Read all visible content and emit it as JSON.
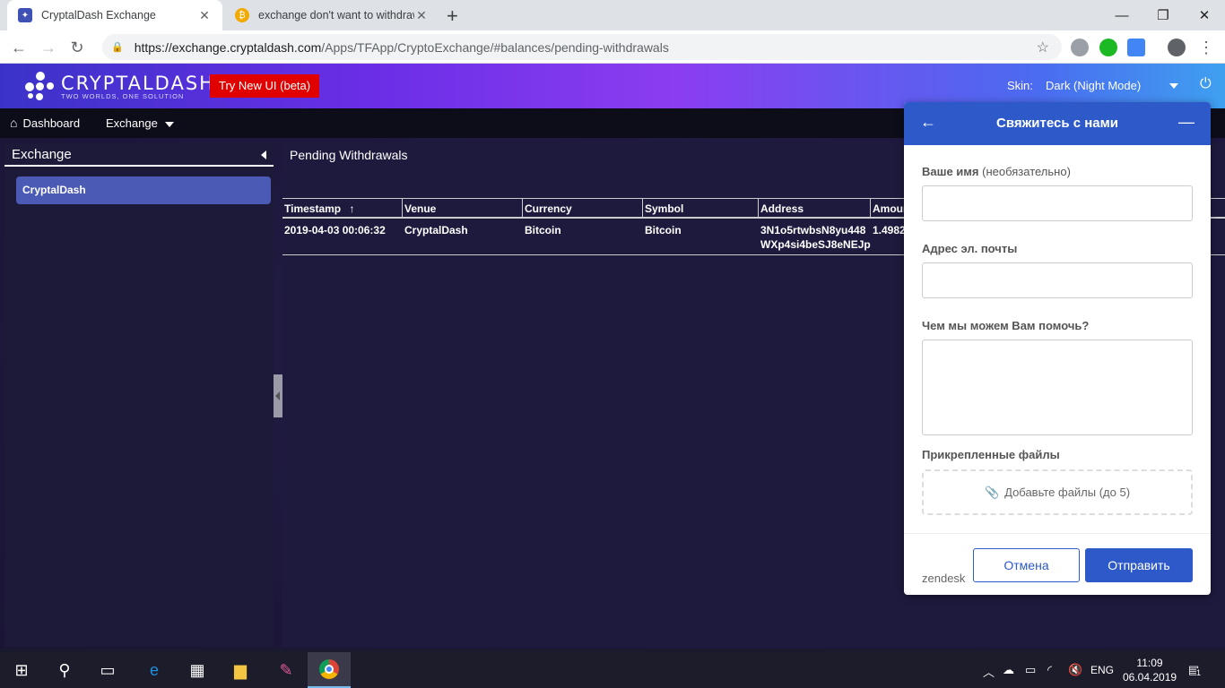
{
  "browser": {
    "tabs": [
      {
        "title": "CryptalDash Exchange",
        "active": true
      },
      {
        "title": "exchange don't want to withdraw",
        "active": false
      }
    ],
    "url_host": "https://exchange.cryptaldash.com",
    "url_path": "/Apps/TFApp/CryptoExchange/#balances/pending-withdrawals"
  },
  "header": {
    "logo_name": "CRYPTALDASH",
    "logo_tagline": "TWO WORLDS, ONE SOLUTION",
    "try_new_label": "Try New UI (beta)",
    "skin_label": "Skin:",
    "skin_value": "Dark (Night Mode)"
  },
  "navbar": {
    "dashboard": "Dashboard",
    "exchange": "Exchange"
  },
  "sidebar": {
    "title": "Exchange",
    "items": [
      {
        "label": "CryptalDash"
      }
    ]
  },
  "main": {
    "title": "Pending Withdrawals",
    "columns": [
      "Timestamp",
      "Venue",
      "Currency",
      "Symbol",
      "Address",
      "Amoun"
    ],
    "rows": [
      {
        "timestamp": "2019-04-03 00:06:32",
        "venue": "CryptalDash",
        "currency": "Bitcoin",
        "symbol": "Bitcoin",
        "address_line1": "3N1o5rtwbsN8yu448",
        "address_line2": "WXp4si4beSJ8eNEJp",
        "amount": "1.4982"
      }
    ]
  },
  "zendesk": {
    "title": "Свяжитесь с нами",
    "name_label": "Ваше имя",
    "name_optional": "(необязательно)",
    "email_label": "Адрес эл. почты",
    "help_label": "Чем мы можем Вам помочь?",
    "attachments_label": "Прикрепленные файлы",
    "attach_button": "Добавьте файлы (до 5)",
    "brand": "zendesk",
    "cancel_label": "Отмена",
    "send_label": "Отправить"
  },
  "taskbar": {
    "language": "ENG",
    "time": "11:09",
    "date": "06.04.2019",
    "notification_count": "1"
  },
  "colors": {
    "accent": "#2d5ac8",
    "try_new_bg": "#e00000",
    "sidebar_item": "#4a5ab5"
  }
}
